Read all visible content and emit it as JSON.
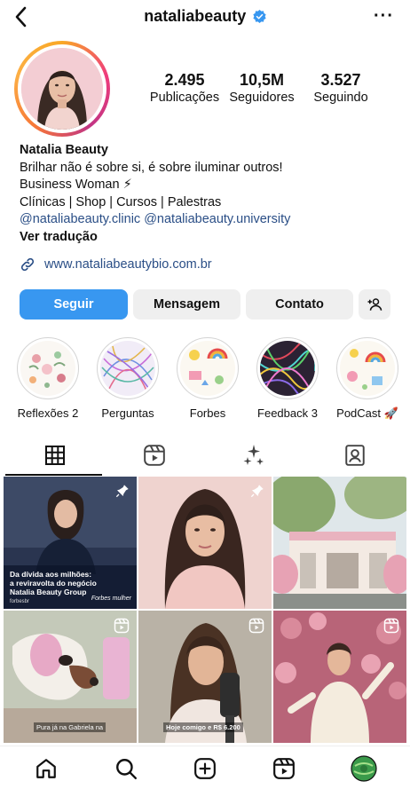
{
  "header": {
    "username": "nataliabeauty",
    "verified_icon": "verified-badge-icon",
    "back_icon": "chevron-left-icon",
    "more_label": "···"
  },
  "stats": {
    "posts_count": "2.495",
    "posts_label": "Publicações",
    "followers_count": "10,5M",
    "followers_label": "Seguidores",
    "following_count": "3.527",
    "following_label": "Seguindo"
  },
  "bio": {
    "name": "Natalia Beauty",
    "line1": "Brilhar não é sobre si, é sobre iluminar outros!",
    "line2": "Business Woman ⚡",
    "line3": "Clínicas | Shop | Cursos | Palestras",
    "mention1": "@nataliabeauty.clinic",
    "mention2": "@nataliabeauty.university",
    "translate": "Ver tradução",
    "link": "www.nataliabeautybio.com.br"
  },
  "actions": {
    "follow": "Seguir",
    "message": "Mensagem",
    "contact": "Contato"
  },
  "highlights": [
    {
      "label": "Reflexões 2"
    },
    {
      "label": "Perguntas"
    },
    {
      "label": "Forbes"
    },
    {
      "label": "Feedback 3"
    },
    {
      "label": "PodCast 🚀"
    }
  ],
  "tabs": [
    "grid-icon",
    "reels-icon",
    "sparkles-icon",
    "tagged-icon"
  ],
  "posts": {
    "post1_caption": "Da dívida aos milhões:\na reviravolta do negócio\nNatalia Beauty Group",
    "post1_brand": "Forbes mulher",
    "post1_credit": "forbesbr",
    "post4_sub": "Pura já na Gabriela na",
    "post5_sub": "Hoje comigo e R$ 6.200"
  },
  "bottom_nav": [
    "home-icon",
    "search-icon",
    "create-icon",
    "reels-icon",
    "profile-avatar"
  ],
  "colors": {
    "follow_button": "#3897f0",
    "link": "#2a4e86",
    "verified": "#3897f0"
  }
}
